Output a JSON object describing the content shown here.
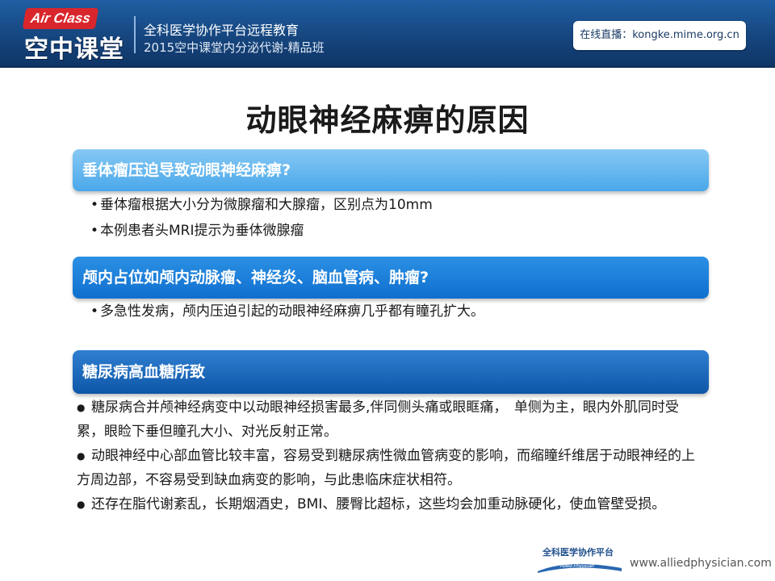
{
  "header": {
    "logo_badge": "Air Class",
    "logo_cn": "空中课堂",
    "line1": "全科医学协作平台远程教育",
    "line2": "2015空中课堂内分泌代谢-精品班",
    "live": "在线直播：kongke.mime.org.cn"
  },
  "title": "动眼神经麻痹的原因",
  "sections": [
    {
      "heading": "垂体瘤压迫导致动眼神经麻痹?",
      "bullets": [
        "垂体瘤根据大小分为微腺瘤和大腺瘤，区别点为10mm",
        "本例患者头MRI提示为垂体微腺瘤"
      ]
    },
    {
      "heading": "颅内占位如颅内动脉瘤、神经炎、脑血管病、肿瘤?",
      "bullets": [
        "多急性发病，颅内压迫引起的动眼神经麻痹几乎都有瞳孔扩大。"
      ]
    },
    {
      "heading": "糖尿病高血糖所致",
      "bullets": [
        "糖尿病合并颅神经病变中以动眼神经损害最多,伴同侧头痛或眼眶痛，　单侧为主，眼内外肌同时受累，眼睑下垂但瞳孔大小、对光反射正常。",
        "动眼神经中心部血管比较丰富，容易受到糖尿病性微血管病变的影响，而缩瞳纤维居于动眼神经的上方周边部，不容易受到缺血病变的影响，与此患临床症状相符。",
        "还存在脂代谢紊乱，长期烟酒史，BMI、腰臀比超标，这些均会加重动脉硬化，使血管壁受损。"
      ]
    }
  ],
  "footer": {
    "logo_text": "全科医学协作平台",
    "logo_sub": "Allied Physician",
    "url": "www.alliedphysician.com"
  },
  "colors": {
    "header_bg": "#16467f",
    "bar_light": "#4aa8ea",
    "bar_mid": "#0f6fcf",
    "bar_dark": "#0e56a8",
    "badge_red": "#d9262c"
  }
}
